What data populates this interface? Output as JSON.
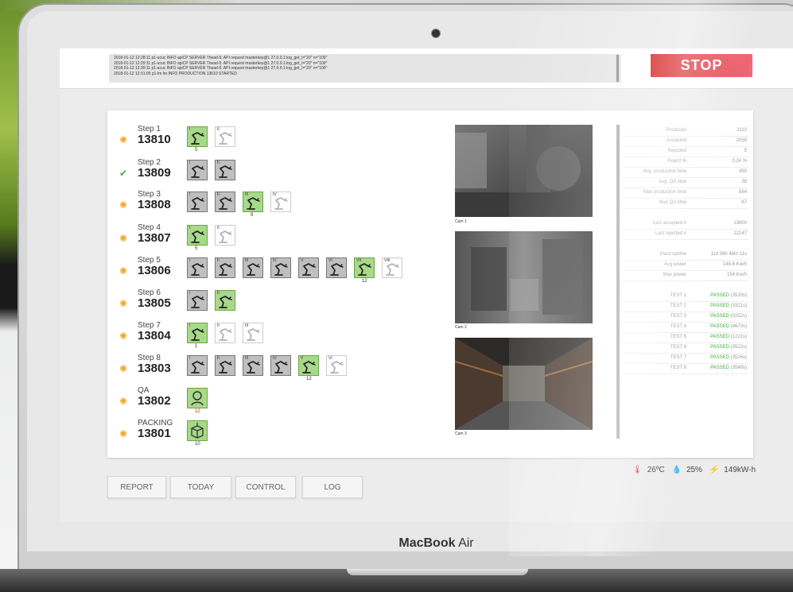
{
  "log": {
    "lines": [
      "2018-01-12 12:28:11 p1-ucuc INFO apiCP SERVER Thead-5: API request masterkey@1 27.0.0.1:log_get_l=\"20\" n=\"100\"",
      "2018-01-12 12:29:11 p1-ucuc INFO apiCP SERVER Thead-5: API request masterkey@1 27.0.0.1:log_get_l=\"20\" n=\"100\"",
      "2018-01-12 12:30:11 p1-ucuc INFO apiCP SERVER Thead-5: API request masterkey@1 27.0.0.1:log_get_l=\"20\" n=\"100\"",
      "2018-01-12 12:31:05 p1-lm lm INFO PRODUCTION 13610 STARTED"
    ]
  },
  "stop_label": "STOP",
  "steps": [
    {
      "label": "Step 1",
      "number": "13810",
      "status": "running",
      "robots": [
        {
          "roman": "I",
          "state": "green",
          "count": "5"
        },
        {
          "roman": "II",
          "state": "ghost"
        }
      ]
    },
    {
      "label": "Step 2",
      "number": "13809",
      "status": "done",
      "robots": [
        {
          "roman": "I",
          "state": "grey"
        },
        {
          "roman": "II",
          "state": "grey"
        }
      ]
    },
    {
      "label": "Step 3",
      "number": "13808",
      "status": "running",
      "robots": [
        {
          "roman": "I",
          "state": "grey"
        },
        {
          "roman": "II",
          "state": "grey"
        },
        {
          "roman": "III",
          "state": "green",
          "count": "9"
        },
        {
          "roman": "IV",
          "state": "ghost"
        }
      ]
    },
    {
      "label": "Step 4",
      "number": "13807",
      "status": "running",
      "robots": [
        {
          "roman": "I",
          "state": "green",
          "count": "5"
        },
        {
          "roman": "II",
          "state": "ghost"
        }
      ]
    },
    {
      "label": "Step 5",
      "number": "13806",
      "status": "running",
      "robots": [
        {
          "roman": "I",
          "state": "grey"
        },
        {
          "roman": "II",
          "state": "grey"
        },
        {
          "roman": "III",
          "state": "grey"
        },
        {
          "roman": "IV",
          "state": "grey"
        },
        {
          "roman": "V",
          "state": "grey"
        },
        {
          "roman": "VI",
          "state": "grey"
        },
        {
          "roman": "VII",
          "state": "green",
          "count": "12"
        },
        {
          "roman": "VIII",
          "state": "ghost"
        }
      ]
    },
    {
      "label": "Step 6",
      "number": "13805",
      "status": "running",
      "robots": [
        {
          "roman": "I",
          "state": "grey"
        },
        {
          "roman": "II",
          "state": "green"
        }
      ]
    },
    {
      "label": "Step 7",
      "number": "13804",
      "status": "running",
      "robots": [
        {
          "roman": "I",
          "state": "green",
          "count": "1"
        },
        {
          "roman": "II",
          "state": "ghost"
        },
        {
          "roman": "III",
          "state": "ghost"
        }
      ]
    },
    {
      "label": "Step 8",
      "number": "13803",
      "status": "running",
      "robots": [
        {
          "roman": "I",
          "state": "grey"
        },
        {
          "roman": "II",
          "state": "grey"
        },
        {
          "roman": "III",
          "state": "grey"
        },
        {
          "roman": "IV",
          "state": "grey"
        },
        {
          "roman": "V",
          "state": "green",
          "count": "12"
        },
        {
          "roman": "VI",
          "state": "ghost"
        }
      ]
    },
    {
      "label": "QA",
      "number": "13802",
      "status": "running",
      "robots": [
        {
          "roman": "",
          "state": "green",
          "count": "12",
          "count_color": "red",
          "icon": "qa"
        }
      ]
    },
    {
      "label": "PACKING",
      "number": "13801",
      "status": "running",
      "robots": [
        {
          "roman": "",
          "state": "green",
          "count": "10",
          "icon": "box"
        }
      ]
    }
  ],
  "cams": [
    "Cam 1",
    "Cam 2",
    "Cam 3"
  ],
  "stats": {
    "production": [
      {
        "k": "Produced",
        "v": "2110"
      },
      {
        "k": "Accepted",
        "v": "2059"
      },
      {
        "k": "Rejected",
        "v": "5"
      },
      {
        "k": "Reject %",
        "v": "0,24 %"
      },
      {
        "k": "Avg. production time",
        "v": "459"
      },
      {
        "k": "Avg. QA time",
        "v": "38"
      },
      {
        "k": "Max production time",
        "v": "564"
      },
      {
        "k": "Max QA time",
        "v": "67"
      }
    ],
    "last": [
      {
        "k": "Last accepted #",
        "v": "13800"
      },
      {
        "k": "Last rejected #",
        "v": "12147"
      }
    ],
    "plant": [
      {
        "k": "Plant uptime",
        "v": "11d 06h 48m 11s"
      },
      {
        "k": "Avg power",
        "v": "148,6 Kw/h"
      },
      {
        "k": "Max power",
        "v": "154 Kw/h"
      }
    ],
    "tests": [
      {
        "k": "TEST 1",
        "status": "PASSED",
        "time": "(3520s)"
      },
      {
        "k": "TEST 2",
        "status": "PASSED",
        "time": "(3321s)"
      },
      {
        "k": "TEST 3",
        "status": "PASSED",
        "time": "(0252s)"
      },
      {
        "k": "TEST 4",
        "status": "PASSED",
        "time": "(4670s)"
      },
      {
        "k": "TEST 5",
        "status": "PASSED",
        "time": "(1221s)"
      },
      {
        "k": "TEST 6",
        "status": "PASSED",
        "time": "(3522s)"
      },
      {
        "k": "TEST 7",
        "status": "PASSED",
        "time": "(3526s)"
      },
      {
        "k": "TEST 8",
        "status": "PASSED",
        "time": "(3549s)"
      }
    ]
  },
  "buttons": [
    "REPORT",
    "TODAY",
    "CONTROL",
    "LOG"
  ],
  "env": {
    "temp": "26ºC",
    "humidity": "25%",
    "power": "149kW-h"
  },
  "brand": {
    "bold": "MacBook",
    "light": "Air"
  },
  "colors": {
    "stop_start": "#d40e0e",
    "stop_end": "#f0697a",
    "passed": "#38b33a",
    "robot_active": "#a8d98a"
  }
}
